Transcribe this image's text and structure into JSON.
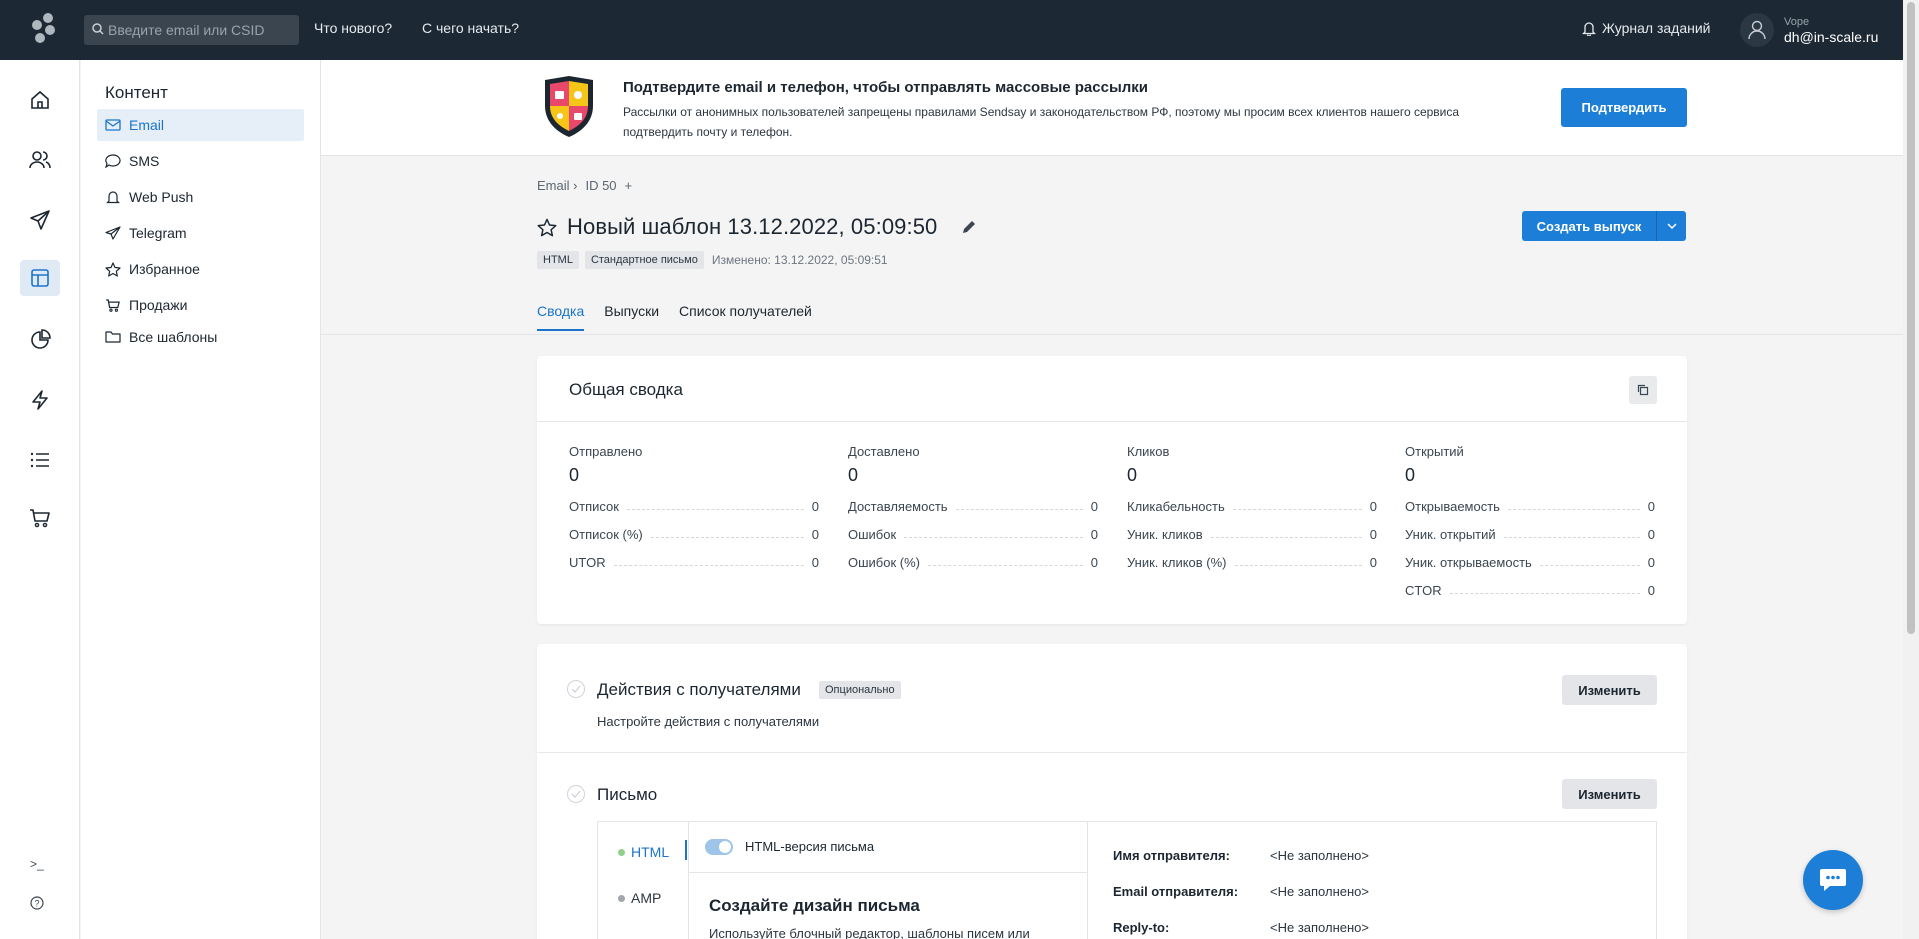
{
  "topbar": {
    "search_placeholder": "Введите email или CSID",
    "whats_new": "Что нового?",
    "getting_started": "С чего начать?",
    "jobs_log": "Журнал заданий",
    "user_role": "Vope",
    "user_email": "dh@in-scale.ru"
  },
  "submenu": {
    "title": "Контент",
    "items": [
      {
        "label": "Email",
        "icon": "mail-icon"
      },
      {
        "label": "SMS",
        "icon": "chat-bubble-icon"
      },
      {
        "label": "Web Push",
        "icon": "bell-icon"
      },
      {
        "label": "Telegram",
        "icon": "telegram-icon"
      },
      {
        "label": "Избранное",
        "icon": "star-icon"
      },
      {
        "label": "Продажи",
        "icon": "cart-icon"
      },
      {
        "label": "Все шаблоны",
        "icon": "folder-icon"
      }
    ]
  },
  "banner": {
    "title": "Подтвердите email и телефон, чтобы отправлять массовые рассылки",
    "description": "Рассылки от анонимных пользователей запрещены правилами Sendsay и законодательством РФ, поэтому мы просим всех клиентов нашего сервиса подтвердить почту и телефон.",
    "button": "Подтвердить"
  },
  "breadcrumb": {
    "root": "Email ›",
    "id": "ID 50",
    "add": "+"
  },
  "template": {
    "title": "Новый шаблон 13.12.2022, 05:09:50",
    "tags": [
      "HTML",
      "Стандартное письмо"
    ],
    "changed": "Изменено: 13.12.2022, 05:09:51",
    "create_button": "Создать выпуск"
  },
  "tabs": [
    "Сводка",
    "Выпуски",
    "Список получателей"
  ],
  "summary": {
    "title": "Общая сводка",
    "columns": [
      {
        "label": "Отправлено",
        "value": "0",
        "rows": [
          [
            "Отписок",
            "0"
          ],
          [
            "Отписок (%)",
            "0"
          ],
          [
            "UTOR",
            "0"
          ]
        ]
      },
      {
        "label": "Доставлено",
        "value": "0",
        "rows": [
          [
            "Доставляемость",
            "0"
          ],
          [
            "Ошибок",
            "0"
          ],
          [
            "Ошибок (%)",
            "0"
          ]
        ]
      },
      {
        "label": "Кликов",
        "value": "0",
        "rows": [
          [
            "Кликабельность",
            "0"
          ],
          [
            "Уник. кликов",
            "0"
          ],
          [
            "Уник. кликов (%)",
            "0"
          ]
        ]
      },
      {
        "label": "Открытий",
        "value": "0",
        "rows": [
          [
            "Открываемость",
            "0"
          ],
          [
            "Уник. открытий",
            "0"
          ],
          [
            "Уник. открываемость",
            "0"
          ],
          [
            "CTOR",
            "0"
          ]
        ]
      }
    ]
  },
  "actions": {
    "title": "Действия с получателями",
    "badge": "Опционально",
    "description": "Настройте действия с получателями",
    "button": "Изменить"
  },
  "letter": {
    "title": "Письмо",
    "button": "Изменить",
    "versions": [
      {
        "label": "HTML",
        "color": "#8fd18a"
      },
      {
        "label": "AMP",
        "color": "#a0a6ab"
      }
    ],
    "toggle_label": "HTML-версия письма",
    "design_title": "Создайте дизайн письма",
    "design_desc": "Используйте блочный редактор, шаблоны писем или",
    "meta": [
      {
        "key": "Имя отправителя:",
        "value": "<Не заполнено>"
      },
      {
        "key": "Email отправителя:",
        "value": "<Не заполнено>"
      },
      {
        "key": "Reply-to:",
        "value": "<Не заполнено>"
      }
    ]
  },
  "colors": {
    "accent": "#1d7ed8",
    "topbar": "#1c2833"
  }
}
